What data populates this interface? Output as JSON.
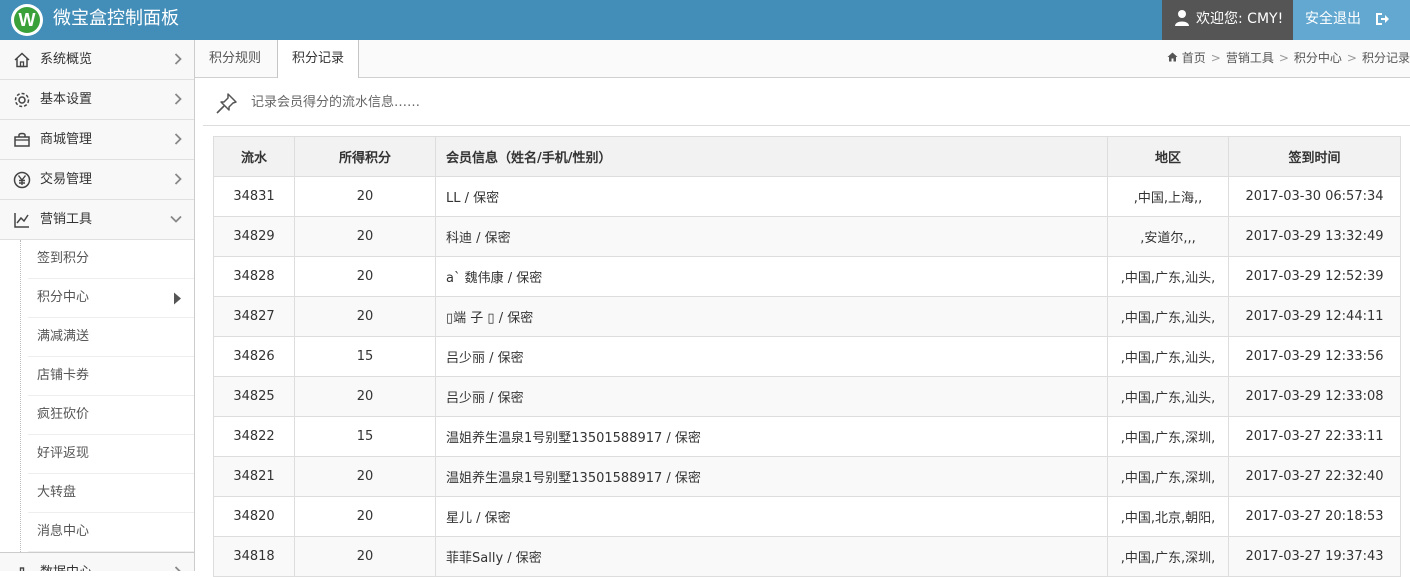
{
  "header": {
    "title": "微宝盒控制面板",
    "logo_letter": "W",
    "welcome": "欢迎您: CMY!",
    "logout_label": "安全退出",
    "bg_color": "#438eb9"
  },
  "sidebar": {
    "items": [
      {
        "label": "系统概览",
        "icon": "home-icon"
      },
      {
        "label": "基本设置",
        "icon": "gear-icon"
      },
      {
        "label": "商城管理",
        "icon": "shop-icon"
      },
      {
        "label": "交易管理",
        "icon": "yen-icon"
      },
      {
        "label": "营销工具",
        "icon": "chart-icon",
        "expanded": true
      }
    ],
    "subitems": [
      {
        "label": "签到积分"
      },
      {
        "label": "积分中心",
        "active": true
      },
      {
        "label": "满减满送"
      },
      {
        "label": "店铺卡券"
      },
      {
        "label": "疯狂砍价"
      },
      {
        "label": "好评返现"
      },
      {
        "label": "大转盘"
      },
      {
        "label": "消息中心"
      }
    ],
    "more_item": {
      "label": "数据中心",
      "icon": "data-icon"
    }
  },
  "tabs": [
    {
      "label": "积分规则"
    },
    {
      "label": "积分记录",
      "active": true
    }
  ],
  "breadcrumb": [
    "首页",
    "营销工具",
    "积分中心",
    "积分记录"
  ],
  "info_text": "记录会员得分的流水信息……",
  "table": {
    "headers": [
      "流水",
      "所得积分",
      "会员信息（姓名/手机/性别）",
      "地区",
      "签到时间"
    ],
    "rows": [
      [
        "34831",
        "20",
        "LL / 保密",
        ",中国,上海,,",
        "2017-03-30 06:57:34"
      ],
      [
        "34829",
        "20",
        "科迪 / 保密",
        ",安道尔,,,",
        "2017-03-29 13:32:49"
      ],
      [
        "34828",
        "20",
        "a` 魏伟康 / 保密",
        ",中国,广东,汕头,",
        "2017-03-29 12:52:39"
      ],
      [
        "34827",
        "20",
        "▯端 子 ▯ / 保密",
        ",中国,广东,汕头,",
        "2017-03-29 12:44:11"
      ],
      [
        "34826",
        "15",
        "吕少丽 / 保密",
        ",中国,广东,汕头,",
        "2017-03-29 12:33:56"
      ],
      [
        "34825",
        "20",
        "吕少丽 / 保密",
        ",中国,广东,汕头,",
        "2017-03-29 12:33:08"
      ],
      [
        "34822",
        "15",
        "温姐养生温泉1号别墅13501588917 / 保密",
        ",中国,广东,深圳,",
        "2017-03-27 22:33:11"
      ],
      [
        "34821",
        "20",
        "温姐养生温泉1号别墅13501588917 / 保密",
        ",中国,广东,深圳,",
        "2017-03-27 22:32:40"
      ],
      [
        "34820",
        "20",
        "星儿 / 保密",
        ",中国,北京,朝阳,",
        "2017-03-27 20:18:53"
      ],
      [
        "34818",
        "20",
        "菲菲Sally / 保密",
        ",中国,广东,深圳,",
        "2017-03-27 19:37:43"
      ]
    ]
  }
}
